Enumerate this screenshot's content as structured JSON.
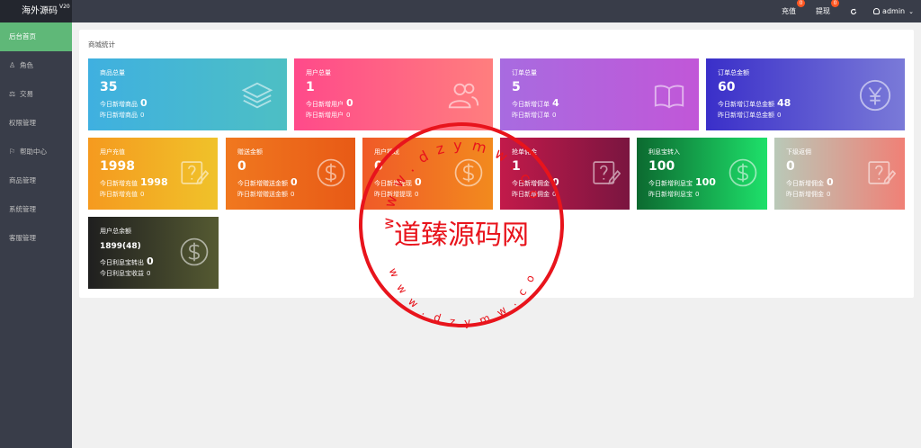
{
  "header": {
    "brand": "海外源码",
    "version": "V20",
    "recharge_label": "充值",
    "recharge_badge": "0",
    "withdraw_label": "提现",
    "withdraw_badge": "0",
    "refresh_icon": "refresh-icon",
    "user": "admin"
  },
  "sidebar": {
    "items": [
      {
        "label": "后台首页",
        "icon": "",
        "active": true
      },
      {
        "label": "角色",
        "icon": "user-icon"
      },
      {
        "label": "交易",
        "icon": "scale-icon"
      },
      {
        "label": "权限管理",
        "icon": ""
      },
      {
        "label": "帮助中心",
        "icon": "flag-icon"
      },
      {
        "label": "商品管理",
        "icon": ""
      },
      {
        "label": "系统管理",
        "icon": ""
      },
      {
        "label": "客服管理",
        "icon": ""
      }
    ]
  },
  "main": {
    "title": "商城统计",
    "cards": [
      {
        "title": "商品总量",
        "value": "35",
        "line1_label": "今日新增商品",
        "line1_value": "0",
        "line2_label": "昨日新增商品",
        "line2_value": "0",
        "icon": "layers-icon",
        "color_from": "#3fb0e0",
        "color_to": "#4dbfc4"
      },
      {
        "title": "用户总量",
        "value": "1",
        "line1_label": "今日新增用户",
        "line1_value": "0",
        "line2_label": "昨日新增用户",
        "line2_value": "0",
        "icon": "users-icon",
        "color_from": "#ff4a8a",
        "color_to": "#ff7e7e"
      },
      {
        "title": "订单总量",
        "value": "5",
        "line1_label": "今日新增订单",
        "line1_value": "4",
        "line2_label": "昨日新增订单",
        "line2_value": "0",
        "icon": "book-icon",
        "color_from": "#a86be0",
        "color_to": "#c157d8"
      },
      {
        "title": "订单总金额",
        "value": "60",
        "line1_label": "今日新增订单总金额",
        "line1_value": "48",
        "line2_label": "昨日新增订单总金额",
        "line2_value": "0",
        "icon": "yen-icon",
        "color_from": "#3a2fc9",
        "color_to": "#7a7ad8"
      },
      {
        "title": "用户充值",
        "value": "1998",
        "line1_label": "今日新增充值",
        "line1_value": "1998",
        "line2_label": "昨日新增充值",
        "line2_value": "0",
        "icon": "edit-icon",
        "color_from": "#f59a1f",
        "color_to": "#f0c22a"
      },
      {
        "title": "赠送金额",
        "value": "0",
        "line1_label": "今日新增赠送金额",
        "line1_value": "0",
        "line2_label": "昨日新增赠送金额",
        "line2_value": "0",
        "icon": "dollar-icon",
        "color_from": "#f0781f",
        "color_to": "#e85a16"
      },
      {
        "title": "用户提现",
        "value": "0",
        "line1_label": "今日新增提现",
        "line1_value": "0",
        "line2_label": "昨日新增提现",
        "line2_value": "0",
        "icon": "dollar-icon",
        "color_from": "#f05a28",
        "color_to": "#f28a1e"
      },
      {
        "title": "抢单佣金",
        "value": "1",
        "line1_label": "今日新增佣金",
        "line1_value": "0",
        "line2_label": "昨日新增佣金",
        "line2_value": "0",
        "icon": "edit-icon",
        "color_from": "#c21a4a",
        "color_to": "#7a1540"
      },
      {
        "title": "利息宝转入",
        "value": "100",
        "line1_label": "今日新增利息宝",
        "line1_value": "100",
        "line2_label": "昨日新增利息宝",
        "line2_value": "0",
        "icon": "dollar-icon",
        "color_from": "#0c6a30",
        "color_to": "#1ee06a"
      },
      {
        "title": "下级返佣",
        "value": "0",
        "line1_label": "今日新增佣金",
        "line1_value": "0",
        "line2_label": "昨日新增佣金",
        "line2_value": "0",
        "icon": "edit-icon",
        "color_from": "#b9c9b8",
        "color_to": "#f08076"
      },
      {
        "title": "用户总余额",
        "value": "1899(48)",
        "line1_label": "今日利息宝转出",
        "line1_value": "0",
        "line2_label": "今日利息宝收益",
        "line2_value": "0",
        "icon": "dollar-icon",
        "color_from": "#1f1f1f",
        "color_to": "#555a32"
      }
    ]
  },
  "stamp": {
    "text": "道臻源码网",
    "top_text": "www.dzymw.com",
    "bottom_text": "www.dzymw.com",
    "color": "#e8141c"
  }
}
